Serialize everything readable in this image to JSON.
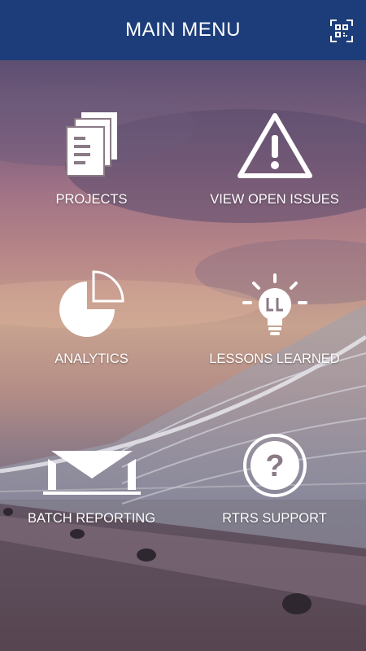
{
  "header": {
    "title": "MAIN MENU",
    "qr_icon": "qr-scan-icon"
  },
  "menu": [
    {
      "label": "PROJECTS",
      "icon": "documents-icon"
    },
    {
      "label": "VIEW OPEN ISSUES",
      "icon": "warning-icon"
    },
    {
      "label": "ANALYTICS",
      "icon": "pie-chart-icon"
    },
    {
      "label": "LESSONS LEARNED",
      "icon": "lightbulb-icon"
    },
    {
      "label": "BATCH REPORTING",
      "icon": "envelope-icon"
    },
    {
      "label": "RTRS SUPPORT",
      "icon": "help-icon"
    }
  ],
  "colors": {
    "header_bg": "#1d3d7a",
    "text": "#ffffff"
  }
}
